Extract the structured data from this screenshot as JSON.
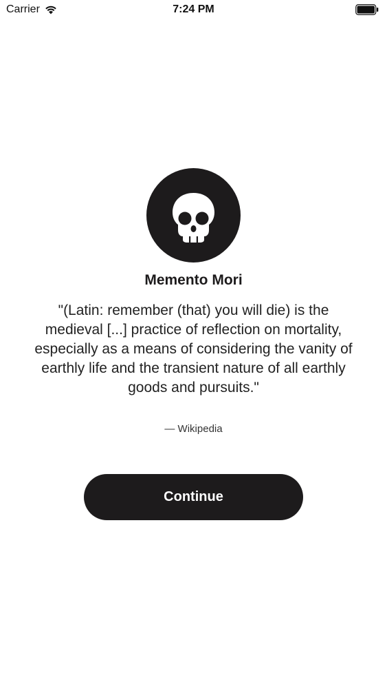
{
  "status_bar": {
    "carrier": "Carrier",
    "time": "7:24 PM",
    "wifi_icon": "wifi-icon",
    "battery_icon": "battery-icon"
  },
  "main": {
    "icon": "skull-icon",
    "title": "Memento Mori",
    "quote": "\"(Latin: remember (that) you will die) is the medieval [...] practice of reflection on mortality, especially as a means of considering the vanity of earthly life and the transient nature of all earthly goods and pursuits.\"",
    "attribution": "— Wikipedia",
    "continue_label": "Continue"
  },
  "colors": {
    "primary": "#1d1b1c",
    "background": "#ffffff",
    "button_text": "#ffffff"
  }
}
